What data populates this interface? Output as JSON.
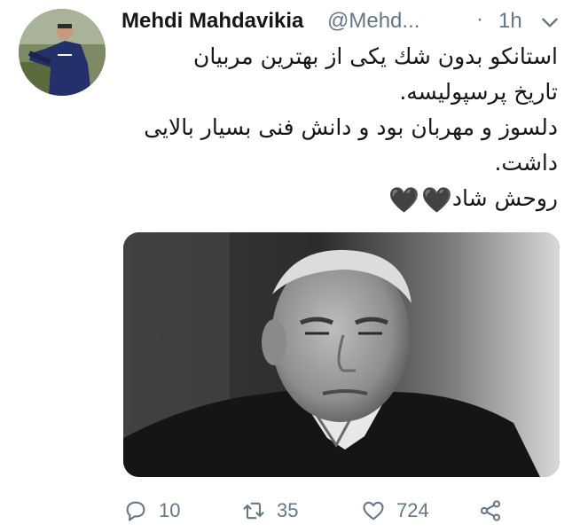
{
  "tweet": {
    "author_name": "Mehdi Mahdavikia",
    "author_handle": "@Mehd...",
    "separator": "·",
    "time": "1h",
    "text_lines": [
      "استانکو بدون شك يکی از بهترين مربيان",
      "تاريخ پرسپوليسه.",
      "دلسوز و مهربان بود و دانش فنی بسيار بالايی",
      "داشت.",
      "روحش شاد"
    ],
    "emoji": [
      "🖤",
      "🖤"
    ],
    "actions": {
      "replies": "10",
      "retweets": "35",
      "likes": "724"
    }
  },
  "icons": {
    "caret": "chevron-down-icon",
    "reply": "reply-icon",
    "retweet": "retweet-icon",
    "like": "heart-icon",
    "share": "share-icon"
  },
  "colors": {
    "text": "#14171a",
    "secondary": "#657786",
    "background": "#ffffff"
  }
}
